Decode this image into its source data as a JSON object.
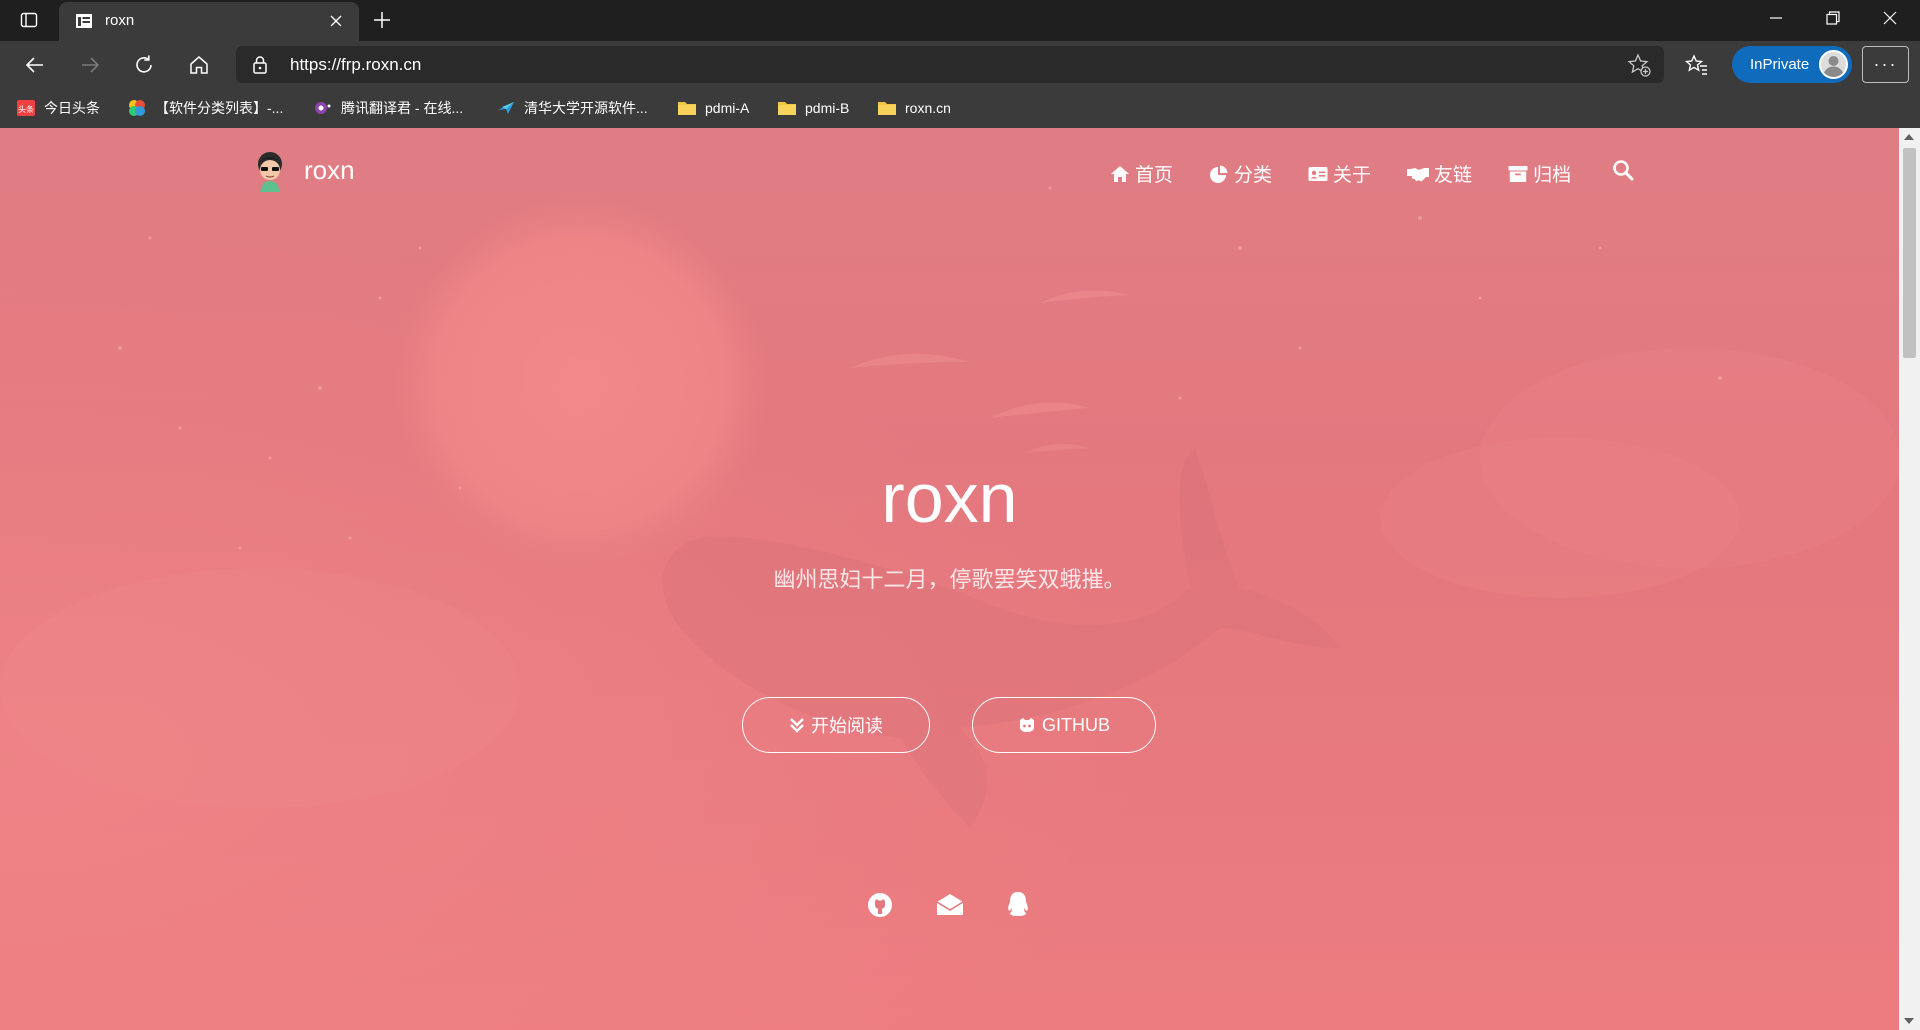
{
  "browser": {
    "tab": {
      "title": "roxn"
    },
    "address": {
      "url": "https://frp.roxn.cn"
    },
    "inprivate_label": "InPrivate",
    "more_label": "···"
  },
  "bookmarks": [
    {
      "label": "今日头条",
      "icon": "toutiao-icon"
    },
    {
      "label": "【软件分类列表】-...",
      "icon": "pinwheel-icon"
    },
    {
      "label": "腾讯翻译君 - 在线...",
      "icon": "translate-icon"
    },
    {
      "label": "清华大学开源软件...",
      "icon": "tsinghua-icon"
    },
    {
      "label": "pdmi-A",
      "icon": "folder-icon"
    },
    {
      "label": "pdmi-B",
      "icon": "folder-icon"
    },
    {
      "label": "roxn.cn",
      "icon": "folder-icon"
    }
  ],
  "site": {
    "brand": "roxn",
    "nav": [
      {
        "label": "首页",
        "icon": "home-icon"
      },
      {
        "label": "分类",
        "icon": "pie-chart-icon"
      },
      {
        "label": "关于",
        "icon": "id-card-icon"
      },
      {
        "label": "友链",
        "icon": "handshake-icon"
      },
      {
        "label": "归档",
        "icon": "archive-icon"
      }
    ],
    "hero_title": "roxn",
    "hero_subtitle": "幽州思妇十二月，停歌罢笑双蛾摧。",
    "buttons": {
      "read": "开始阅读",
      "github": "GITHUB"
    },
    "social": [
      "github-icon",
      "email-icon",
      "qq-icon"
    ]
  },
  "colors": {
    "page_bg": "#e4787e",
    "inprivate": "#0f6cbd",
    "chrome_dark": "#1f1f1f",
    "chrome": "#3b3b3b"
  }
}
